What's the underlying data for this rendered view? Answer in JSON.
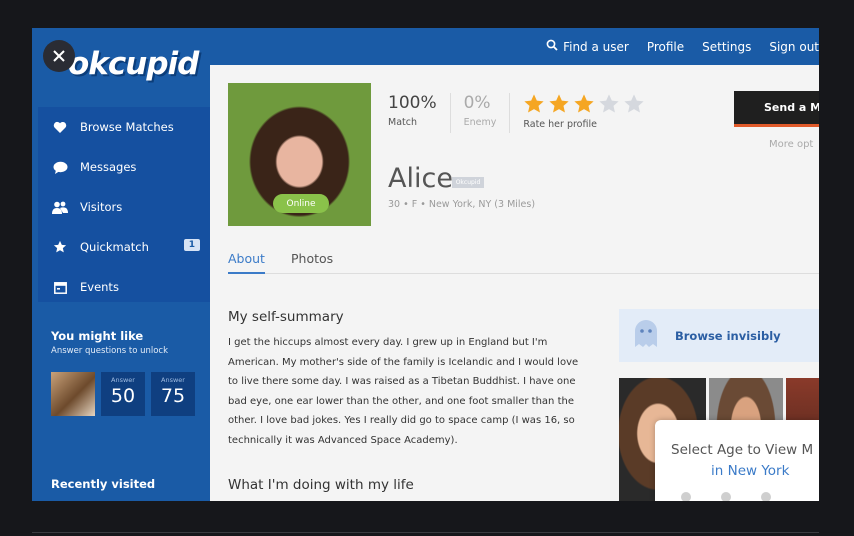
{
  "app": {
    "logo": "okcupid"
  },
  "topnav": {
    "find_user": "Find a user",
    "profile": "Profile",
    "settings": "Settings",
    "sign_out": "Sign out"
  },
  "sidebar": {
    "items": [
      {
        "label": "Browse Matches",
        "icon": "heart-icon"
      },
      {
        "label": "Messages",
        "icon": "speech-bubble-icon"
      },
      {
        "label": "Visitors",
        "icon": "people-icon"
      },
      {
        "label": "Quickmatch",
        "icon": "star-icon",
        "badge": "1"
      },
      {
        "label": "Events",
        "icon": "calendar-icon"
      }
    ],
    "might_like": {
      "title": "You might like",
      "subtitle": "Answer questions to unlock",
      "tiles": [
        {
          "label": "Answer",
          "value": "50"
        },
        {
          "label": "Answer",
          "value": "75"
        }
      ]
    },
    "recently_visited": "Recently visited"
  },
  "profile": {
    "match_pct": "100%",
    "match_label": "Match",
    "enemy_pct": "0%",
    "enemy_label": "Enemy",
    "rate_label": "Rate her profile",
    "rating": 3,
    "rating_max": 5,
    "name": "Alice",
    "tag": "Okcupid",
    "meta": "30 • F • New York, NY (3 Miles)",
    "online": "Online",
    "send_button": "Send a M",
    "more_options": "More opt"
  },
  "tabs": [
    {
      "label": "About",
      "active": true
    },
    {
      "label": "Photos",
      "active": false
    }
  ],
  "content": {
    "summary_title": "My self-summary",
    "summary_lines": [
      "I get the hiccups almost every day. I grew up in England but I'm",
      "American. My mother's side of the family is Icelandic and I would love",
      "to live there some day. I was raised as a Tibetan Buddhist. I have one",
      "bad eye, one ear lower than the other, and one foot smaller than the",
      "other. I love bad jokes. Yes I really did go to space camp (I was 16, so",
      "technically it was Advanced Space Academy)."
    ],
    "life_title": "What I'm doing with my life"
  },
  "right": {
    "browse_invisibly": "Browse invisibly",
    "popup_line1": "Select Age to View M",
    "popup_line2": "in New York"
  },
  "colors": {
    "brand_blue": "#1a5ba6",
    "star_active": "#f5a623",
    "star_inactive": "#d5d8de",
    "online_green": "#8ac24a"
  }
}
